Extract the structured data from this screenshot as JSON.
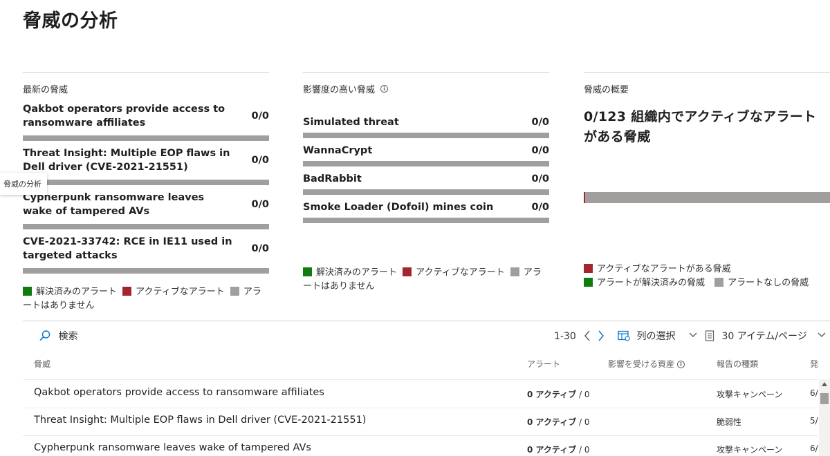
{
  "page": {
    "title": "脅威の分析"
  },
  "tooltip": {
    "text": "脅威の分析"
  },
  "latest": {
    "title": "最新の脅威",
    "items": [
      {
        "name": "Qakbot operators provide access to ransomware affiliates",
        "count": "0/0"
      },
      {
        "name": "Threat Insight: Multiple EOP flaws in Dell driver (CVE-2021-21551)",
        "count": "0/0"
      },
      {
        "name": "Cypherpunk ransomware leaves wake of tampered AVs",
        "count": "0/0"
      },
      {
        "name": "CVE-2021-33742: RCE in IE11 used in targeted attacks",
        "count": "0/0"
      }
    ],
    "legend": {
      "resolved": "解決済みのアラート",
      "active": "アクティブなアラート",
      "none": "アラートはありません"
    }
  },
  "high_impact": {
    "title": "影響度の高い脅威",
    "info_icon": "i",
    "items": [
      {
        "name": "Simulated threat",
        "count": "0/0"
      },
      {
        "name": "WannaCrypt",
        "count": "0/0"
      },
      {
        "name": "BadRabbit",
        "count": "0/0"
      },
      {
        "name": "Smoke Loader (Dofoil) mines coin",
        "count": "0/0"
      }
    ],
    "legend": {
      "resolved": "解決済みのアラート",
      "active": "アクティブなアラート",
      "none": "アラートはありません"
    }
  },
  "overview": {
    "title": "脅威の概要",
    "headline": "0/123 組織内でアクティブなアラートがある脅威",
    "legend": {
      "active": "アクティブなアラートがある脅威",
      "resolved": "アラートが解決済みの脅威",
      "none": "アラートなしの脅威"
    }
  },
  "toolbar": {
    "search_label": "検索",
    "range": "1-30",
    "columns_label": "列の選択",
    "page_size_label": "30 アイテム/ページ"
  },
  "table": {
    "columns": {
      "threat": "脅威",
      "alerts": "アラート",
      "assets": "影響を受ける資産",
      "report_type": "報告の種類",
      "published": "発"
    },
    "rows": [
      {
        "threat": "Qakbot operators provide access to ransomware affiliates",
        "active": "0 アクティブ",
        "total": "/ 0",
        "report_type": "攻撃キャンペーン",
        "published": "6/"
      },
      {
        "threat": "Threat Insight: Multiple EOP flaws in Dell driver (CVE-2021-21551)",
        "active": "0 アクティブ",
        "total": "/ 0",
        "report_type": "脆弱性",
        "published": "5/"
      },
      {
        "threat": "Cypherpunk ransomware leaves wake of tampered AVs",
        "active": "0 アクティブ",
        "total": "/ 0",
        "report_type": "攻撃キャンペーン",
        "published": "6/"
      }
    ]
  },
  "colors": {
    "green": "#107c10",
    "red": "#a4262c",
    "gray": "#a19f9d",
    "accent": "#0078d4"
  }
}
